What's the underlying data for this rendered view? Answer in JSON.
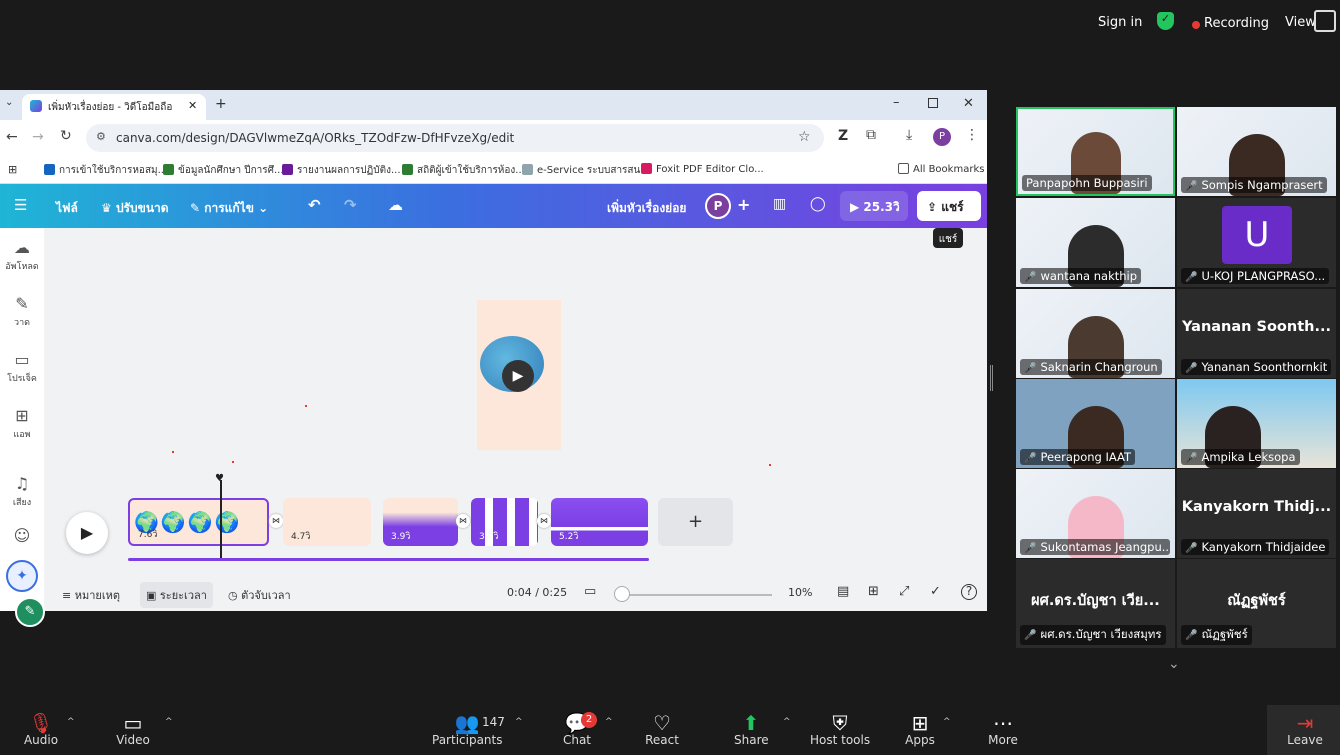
{
  "zoom_top": {
    "sign_in": "Sign in",
    "recording": "Recording",
    "view": "View"
  },
  "browser": {
    "tab_title": "เพิ่มหัวเรื่องย่อย - วิดีโอมือถือ",
    "url": "canva.com/design/DAGVlwmeZqA/ORks_TZOdFzw-DfHFvzeXg/edit",
    "profile_initial": "P",
    "bookmarks": [
      "การเข้าใช้บริการหอสมุ...",
      "ข้อมูลนักศึกษา ปีการศึ...",
      "รายงานผลการปฏิบัติง...",
      "สถิติผู้เข้าใช้บริการห้อง...",
      "e-Service ระบบสารสน...",
      "Foxit PDF Editor Clo...",
      "All Bookmarks"
    ]
  },
  "canva": {
    "menu_file": "ไฟล์",
    "menu_resize": "ปรับขนาด",
    "menu_edit": "การแก้ไข",
    "design_title": "เพิ่มหัวเรื่องย่อย",
    "avatar_initial": "P",
    "duration_button": "25.3วิ",
    "share_label": "แชร์",
    "share_tooltip": "แชร์",
    "sidebar": [
      "อัพโหลด",
      "วาด",
      "โปรเจ็ค",
      "แอพ",
      "เสียง"
    ],
    "clips": [
      "7.6วิ",
      "4.7วิ",
      "3.9วิ",
      "3.7วิ",
      "5.2วิ"
    ],
    "bottom": {
      "notes": "หมายเหตุ",
      "timeline": "ระยะเวลา",
      "timer": "ตัวจับเวลา",
      "time": "0:04 / 0:25",
      "zoom": "10%"
    },
    "playback_position": 0.16
  },
  "participants": [
    {
      "name": "Panpapohn Buppasiri",
      "muted": false
    },
    {
      "name": "Sompis Ngamprasert",
      "muted": true
    },
    {
      "name": "wantana nakthip",
      "muted": true
    },
    {
      "name": "U-KOJ PLANGPRASO...",
      "muted": true,
      "initial": "U"
    },
    {
      "name": "Saknarin Changroun",
      "muted": true
    },
    {
      "name": "Yananan Soonthornkit",
      "muted": true,
      "display": "Yananan  Soonth..."
    },
    {
      "name": "Peerapong IAAT",
      "muted": true
    },
    {
      "name": "Ampika Leksopa",
      "muted": true
    },
    {
      "name": "Sukontamas Jeangpu...",
      "muted": true
    },
    {
      "name": "Kanyakorn Thidjaidee",
      "muted": true,
      "display": "Kanyakorn  Thidj..."
    },
    {
      "name": "ผศ.ดร.บัญชา เวียงสมุทร",
      "muted": true,
      "display": "ผศ.ดร.บัญชา เวีย..."
    },
    {
      "name": "ณัฏฐพัชร์",
      "muted": true,
      "display": "ณัฏฐพัชร์"
    }
  ],
  "zoom_bottom": {
    "audio": "Audio",
    "video": "Video",
    "participants": "Participants",
    "participants_count": "147",
    "chat": "Chat",
    "chat_badge": "2",
    "react": "React",
    "share": "Share",
    "host_tools": "Host tools",
    "apps": "Apps",
    "more": "More",
    "leave": "Leave"
  },
  "colors": {
    "accent": "#7b3fe4",
    "zoom_green": "#22c55e",
    "record_red": "#e53935"
  }
}
